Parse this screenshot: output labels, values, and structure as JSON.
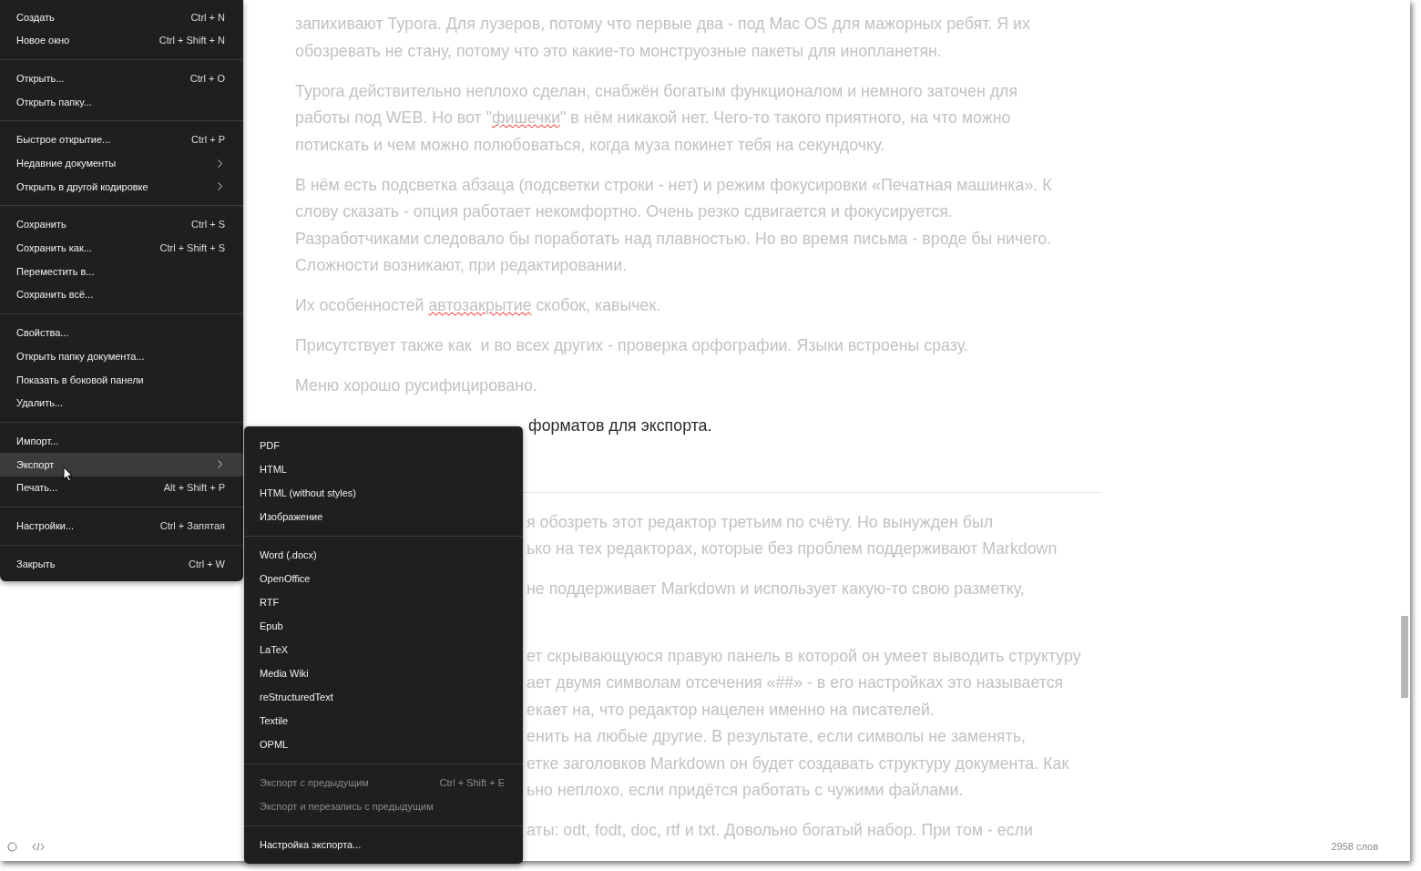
{
  "document": {
    "upper_paragraphs": [
      {
        "focused": false,
        "lines": [
          "запихивают Typora. Для лузеров, потому что первые два - под Mac OS для мажорных ребят. Я их",
          "обозревать не стану, потому что это какие-то монструозные пакеты для инопланетян."
        ]
      },
      {
        "focused": false,
        "lines": [
          "Typora действительно неплохо сделан, снабжён богатым функционалом и немного заточен для",
          [
            {
              "text": "работы под WEB. Но вот \"",
              "misspelled": false
            },
            {
              "text": "фишечки",
              "misspelled": true
            },
            {
              "text": "\" в нём никакой нет. Чего-то такого приятного, на что можно",
              "misspelled": false
            }
          ],
          "потискать и чем можно полюбоваться, когда муза покинет тебя на секундочку."
        ]
      },
      {
        "focused": false,
        "lines": [
          "В нём есть подсветка абзаца (подсветки строки - нет) и режим фокусировки «Печатная машинка». К",
          "слову сказать - опция работает некомфортно. Очень резко сдвигается и фокусируется.",
          "Разработчиками следовало бы поработать над плавностью. Но во время письма - вроде бы ничего.",
          "Сложности возникают, при редактировании."
        ]
      },
      {
        "focused": false,
        "lines": [
          [
            {
              "text": "Их особенностей ",
              "misspelled": false
            },
            {
              "text": "автозакрытие",
              "misspelled": true
            },
            {
              "text": " скобок, кавычек.",
              "misspelled": false
            }
          ]
        ]
      },
      {
        "focused": false,
        "lines": [
          "Присутствует также как  и во всех других - проверка орфографии. Языки встроены сразу."
        ]
      },
      {
        "focused": false,
        "lines": [
          "Меню хорошо русифицировано."
        ]
      },
      {
        "focused": true,
        "lines": [
          "форматов для экспорта."
        ]
      }
    ],
    "lower_paragraphs": [
      {
        "focused": false,
        "lines": [
          "я обозреть этот редактор третьим по счёту. Но вынужден был",
          "ько на тех редакторах, которые без проблем поддерживают Markdown"
        ]
      },
      {
        "focused": false,
        "lines": [
          "не поддерживает Markdown и использует какую-то свою разметку,"
        ]
      },
      {
        "focused": false,
        "lines": [
          "ет скрывающуюся правую панель в которой он умеет выводить структуру",
          "ает двумя символам отсечения «##» - в его настройках это называется",
          "екает на, что редактор нацелен именно на писателей.",
          "енить на любые другие. В результате, если символы не заменять,",
          "етке заголовков Markdown он будет создавать структуру документа. Как",
          "ьно неплохо, если придётся работать с чужими файлами."
        ]
      },
      {
        "focused": false,
        "lines": [
          "аты: odt, fodt, doc, rtf и txt. Довольно богатый набор. При том - если"
        ]
      }
    ]
  },
  "file_menu": {
    "groups": [
      [
        {
          "label": "Создать",
          "shortcut": "Ctrl + N",
          "submenu": false,
          "selected": false
        },
        {
          "label": "Новое окно",
          "shortcut": "Ctrl + Shift + N",
          "submenu": false,
          "selected": false
        }
      ],
      [
        {
          "label": "Открыть...",
          "shortcut": "Ctrl + O",
          "submenu": false,
          "selected": false
        },
        {
          "label": "Открыть папку...",
          "submenu": false,
          "selected": false
        }
      ],
      [
        {
          "label": "Быстрое открытие...",
          "shortcut": "Ctrl + P",
          "submenu": false,
          "selected": false
        },
        {
          "label": "Недавние документы",
          "submenu": true,
          "selected": false
        },
        {
          "label": "Открыть в другой кодировке",
          "submenu": true,
          "selected": false
        }
      ],
      [
        {
          "label": "Сохранить",
          "shortcut": "Ctrl + S",
          "submenu": false,
          "selected": false
        },
        {
          "label": "Сохранить как...",
          "shortcut": "Ctrl + Shift + S",
          "submenu": false,
          "selected": false
        },
        {
          "label": "Переместить в...",
          "submenu": false,
          "selected": false
        },
        {
          "label": "Сохранить всё...",
          "submenu": false,
          "selected": false
        }
      ],
      [
        {
          "label": "Свойства...",
          "submenu": false,
          "selected": false
        },
        {
          "label": "Открыть папку документа...",
          "submenu": false,
          "selected": false
        },
        {
          "label": "Показать в боковой панели",
          "submenu": false,
          "selected": false
        },
        {
          "label": "Удалить...",
          "submenu": false,
          "selected": false
        }
      ],
      [
        {
          "label": "Импорт...",
          "submenu": false,
          "selected": false
        },
        {
          "label": "Экспорт",
          "submenu": true,
          "selected": true
        },
        {
          "label": "Печать...",
          "shortcut": "Alt + Shift + P",
          "submenu": false,
          "selected": false
        }
      ],
      [
        {
          "label": "Настройки...",
          "shortcut": "Ctrl + Запятая",
          "submenu": false,
          "selected": false
        }
      ],
      [
        {
          "label": "Закрыть",
          "shortcut": "Ctrl + W",
          "submenu": false,
          "selected": false
        }
      ]
    ]
  },
  "export_submenu": {
    "groups": [
      [
        {
          "label": "PDF",
          "disabled": false
        },
        {
          "label": "HTML",
          "disabled": false
        },
        {
          "label": "HTML (without styles)",
          "disabled": false
        },
        {
          "label": "Изображение",
          "disabled": false
        }
      ],
      [
        {
          "label": "Word (.docx)",
          "disabled": false
        },
        {
          "label": "OpenOffice",
          "disabled": false
        },
        {
          "label": "RTF",
          "disabled": false
        },
        {
          "label": "Epub",
          "disabled": false
        },
        {
          "label": "LaTeX",
          "disabled": false
        },
        {
          "label": "Media Wiki",
          "disabled": false
        },
        {
          "label": "reStructuredText",
          "disabled": false
        },
        {
          "label": "Textile",
          "disabled": false
        },
        {
          "label": "OPML",
          "disabled": false
        }
      ],
      [
        {
          "label": "Экспорт с предыдущим",
          "shortcut": "Ctrl + Shift + E",
          "disabled": true
        },
        {
          "label": "Экспорт и перезапись с предыдущим",
          "disabled": true
        }
      ],
      [
        {
          "label": "Настройка экспорта...",
          "disabled": false
        }
      ]
    ]
  },
  "status_bar": {
    "word_count": "2958 слов"
  }
}
